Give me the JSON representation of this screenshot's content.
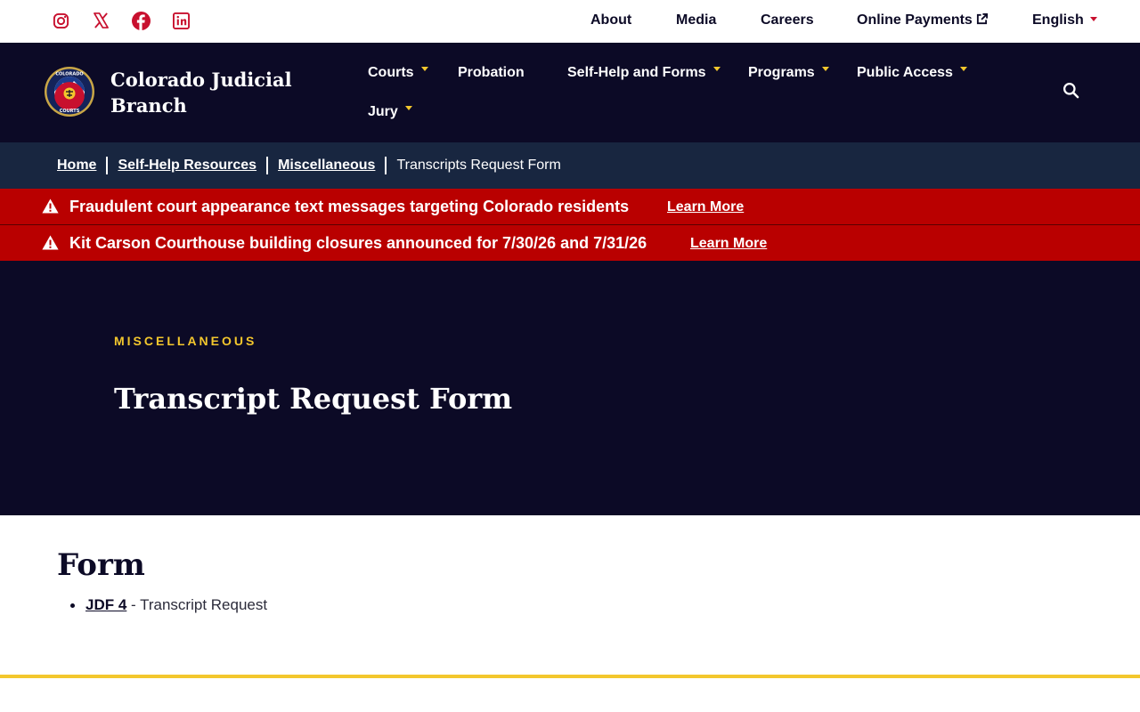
{
  "colors": {
    "navy": "#0c0a26",
    "breadcrumb_bg": "#182640",
    "alert_red": "#b90000",
    "gold": "#f3c72d",
    "social_red": "#c8102e"
  },
  "social": {
    "icons": [
      "instagram-icon",
      "x-twitter-icon",
      "facebook-icon",
      "linkedin-icon"
    ]
  },
  "utility_nav": {
    "about": "About",
    "media": "Media",
    "careers": "Careers",
    "online_payments": "Online Payments",
    "language": "English"
  },
  "header": {
    "site_name_line1": "Colorado Judicial",
    "site_name_line2": "Branch",
    "nav": {
      "courts": "Courts",
      "probation": "Probation",
      "self_help": "Self-Help and Forms",
      "programs": "Programs",
      "public_access": "Public Access",
      "jury": "Jury"
    }
  },
  "breadcrumb": {
    "home": "Home",
    "self_help": "Self-Help Resources",
    "misc": "Miscellaneous",
    "current": "Transcripts Request Form"
  },
  "alerts": [
    {
      "text": "Fraudulent court appearance text messages targeting Colorado residents",
      "link": "Learn More"
    },
    {
      "text": "Kit Carson Courthouse building closures announced for 7/30/26 and 7/31/26",
      "link": "Learn More"
    }
  ],
  "hero": {
    "eyebrow": "MISCELLANEOUS",
    "title": "Transcript Request Form"
  },
  "content": {
    "heading": "Form",
    "items": [
      {
        "link": "JDF 4",
        "desc": " - Transcript Request"
      }
    ]
  }
}
